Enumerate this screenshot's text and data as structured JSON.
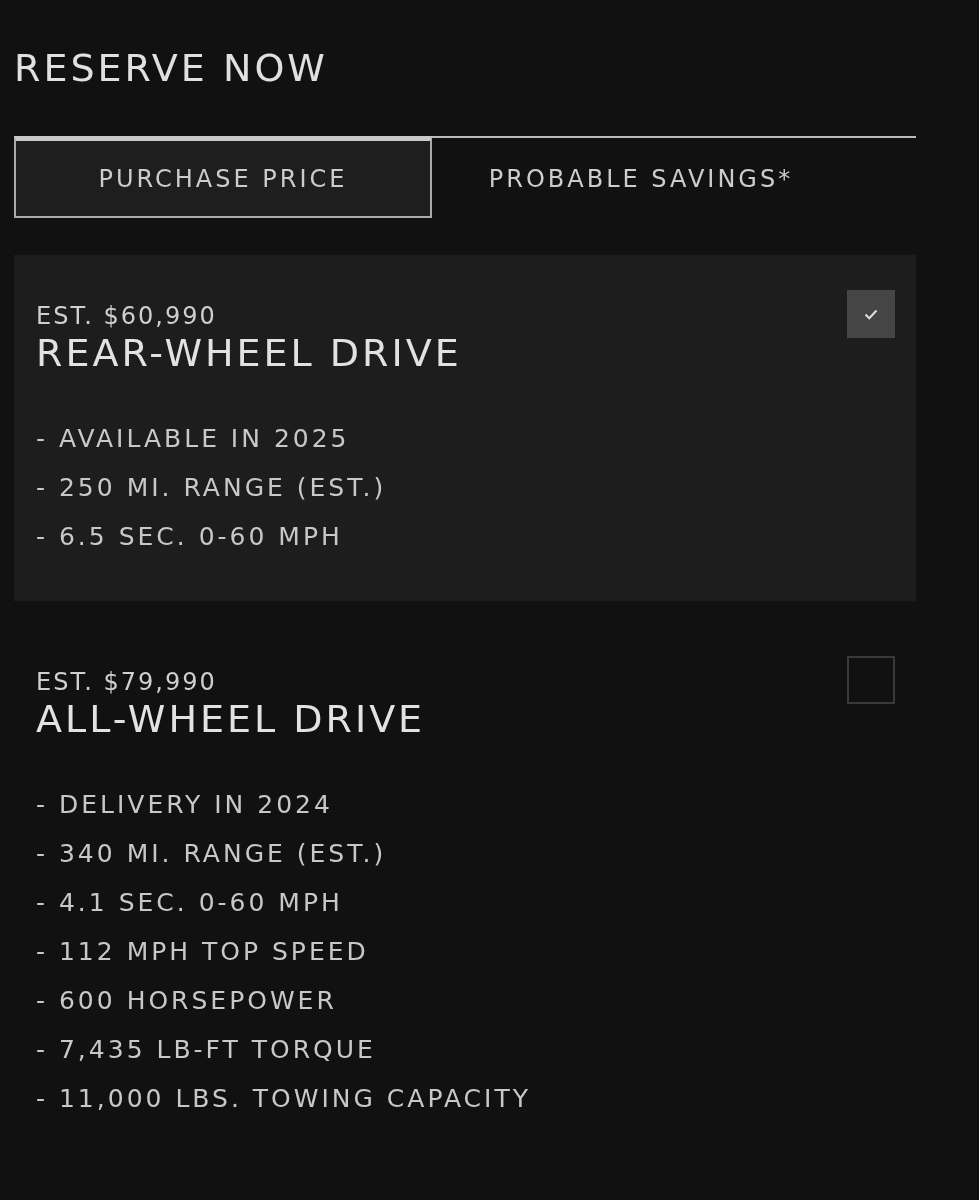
{
  "title": "RESERVE NOW",
  "tabs": [
    {
      "label": "PURCHASE PRICE",
      "selected": true
    },
    {
      "label": "PROBABLE SAVINGS*",
      "selected": false
    }
  ],
  "options": [
    {
      "price": "EST. $60,990",
      "name": "REAR-WHEEL DRIVE",
      "selected": true,
      "features": [
        "- AVAILABLE IN 2025",
        "- 250 MI. RANGE (EST.)",
        "- 6.5 SEC. 0-60 MPH"
      ]
    },
    {
      "price": "EST. $79,990",
      "name": "ALL-WHEEL DRIVE",
      "selected": false,
      "features": [
        "- DELIVERY IN 2024",
        "- 340 MI. RANGE (EST.)",
        "- 4.1 SEC. 0-60 MPH",
        "- 112 MPH TOP SPEED",
        "- 600 HORSEPOWER",
        "- 7,435 LB-FT TORQUE",
        "- 11,000 LBS. TOWING CAPACITY"
      ]
    }
  ]
}
